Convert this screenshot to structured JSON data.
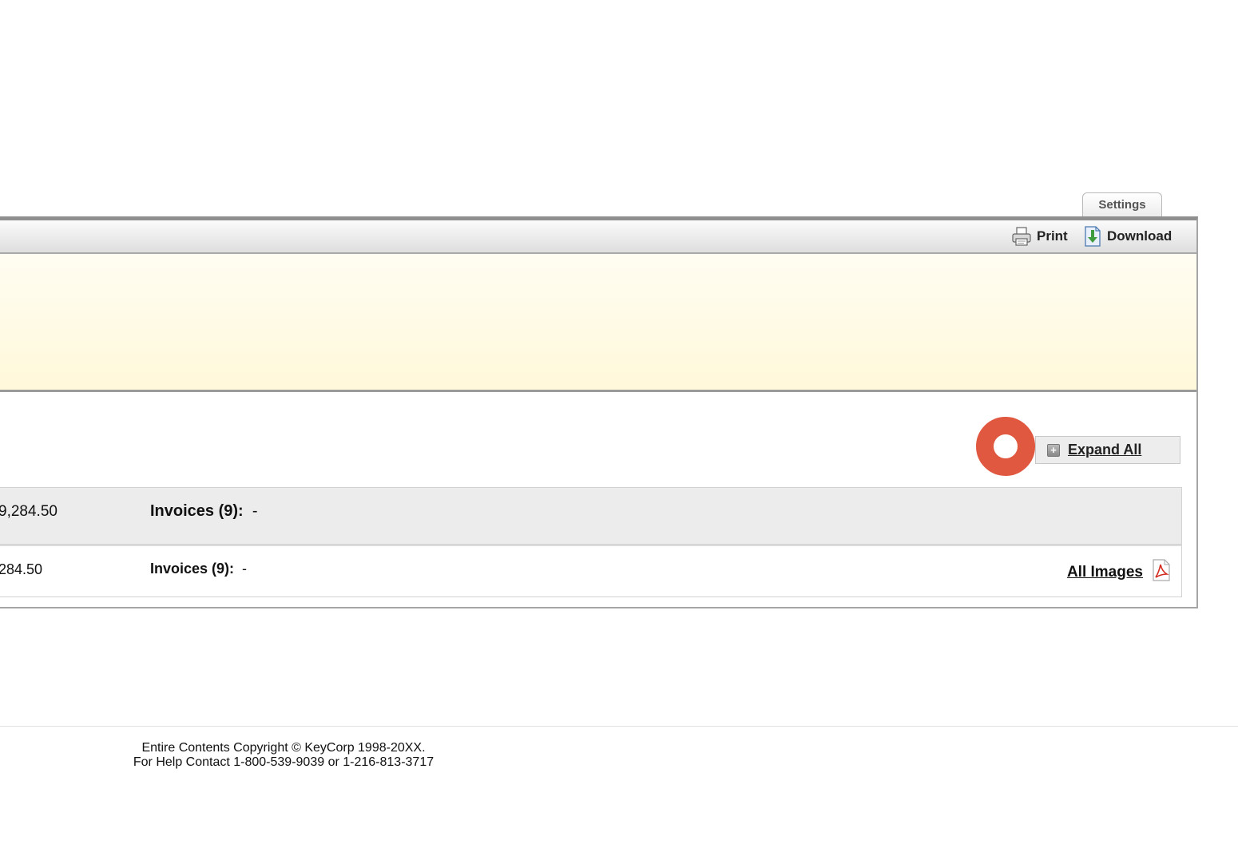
{
  "settings_tab": {
    "label": "Settings"
  },
  "toolbar": {
    "print_label": "Print",
    "download_label": "Download"
  },
  "expand": {
    "label": "Expand All",
    "icon": "plus-square-icon"
  },
  "summary_row": {
    "amount": "9,284.50",
    "invoices_label": "Invoices (9):",
    "invoices_value": "-"
  },
  "detail_row": {
    "amount": "284.50",
    "invoices_label": "Invoices (9):",
    "invoices_value": "-",
    "all_images_label": "All Images",
    "pdf_icon": "pdf-icon"
  },
  "footer": {
    "line1": "Entire Contents Copyright © KeyCorp 1998-20XX.",
    "line2": "For Help Contact 1-800-539-9039 or 1-216-813-3717"
  },
  "colors": {
    "marker": "#e05840",
    "banner": "#fff8da",
    "row_summary_bg": "#ececec"
  }
}
